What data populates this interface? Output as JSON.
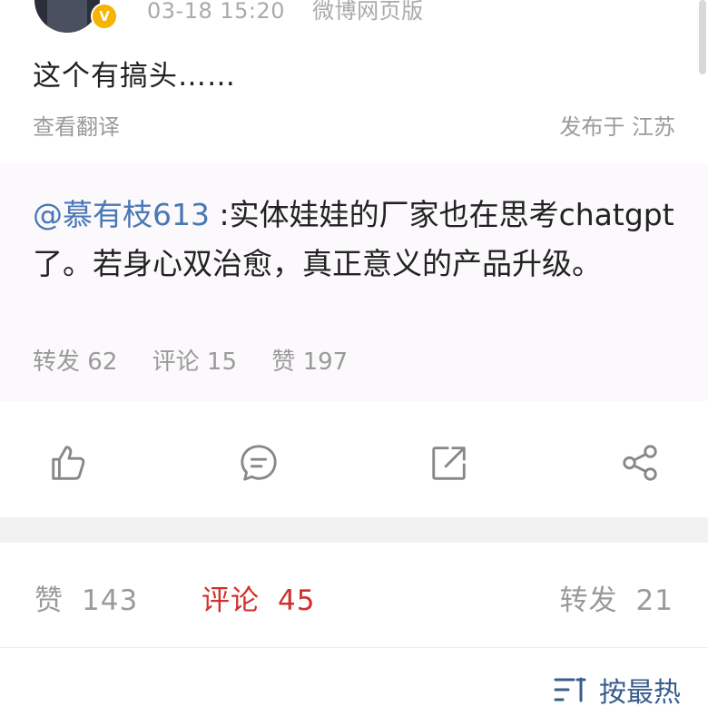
{
  "post": {
    "time": "03-18 15:20",
    "source": "微博网页版",
    "text": "这个有搞头……",
    "translate_label": "查看翻译",
    "location": "发布于 江苏",
    "badge": "V"
  },
  "repost": {
    "mention": "@慕有枝613",
    "text": " :实体娃娃的厂家也在思考chatgpt了。若身心双治愈，真正意义的产品升级。",
    "stats": {
      "forward_label": "转发",
      "forward_count": "62",
      "comment_label": "评论",
      "comment_count": "15",
      "like_label": "赞",
      "like_count": "197"
    }
  },
  "actions": {
    "icons": [
      "thumbs-up-icon",
      "comment-icon",
      "repost-icon",
      "share-icon"
    ]
  },
  "tabs": {
    "like_label": "赞",
    "like_count": "143",
    "comment_label": "评论",
    "comment_count": "45",
    "forward_label": "转发",
    "forward_count": "21"
  },
  "sort": {
    "label": "按最热"
  },
  "colors": {
    "accent_red": "#d0302a",
    "link_blue": "#4a77b5",
    "sort_blue": "#3a5d8c",
    "badge_gold": "#f5b400"
  }
}
